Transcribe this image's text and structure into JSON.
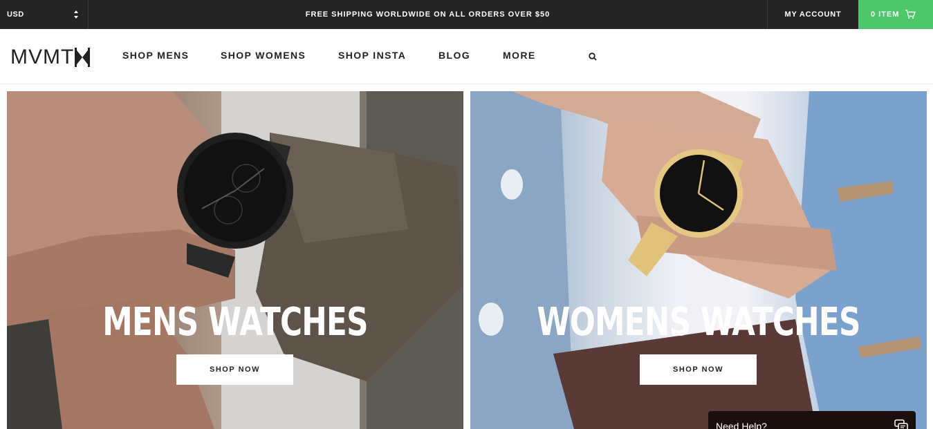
{
  "topbar": {
    "currency": "USD",
    "promo": "FREE SHIPPING WORLDWIDE ON ALL ORDERS OVER $50",
    "account": "MY ACCOUNT",
    "cart": "0 ITEM"
  },
  "nav": {
    "logo": "MVMT",
    "items": [
      "SHOP MENS",
      "SHOP WOMENS",
      "SHOP INSTA",
      "BLOG",
      "MORE"
    ]
  },
  "hero": {
    "men": {
      "title": "MENS WATCHES",
      "button": "SHOP NOW"
    },
    "women": {
      "title": "WOMENS WATCHES",
      "button": "SHOP NOW"
    }
  },
  "chat": {
    "label": "Need Help?"
  },
  "colors": {
    "topbar": "#242424",
    "cart": "#4cc76a",
    "chat": "#1b0f0e"
  },
  "icons": [
    "updown-arrows-icon",
    "cart-icon",
    "logo-mark-icon",
    "search-icon",
    "chat-icon"
  ]
}
